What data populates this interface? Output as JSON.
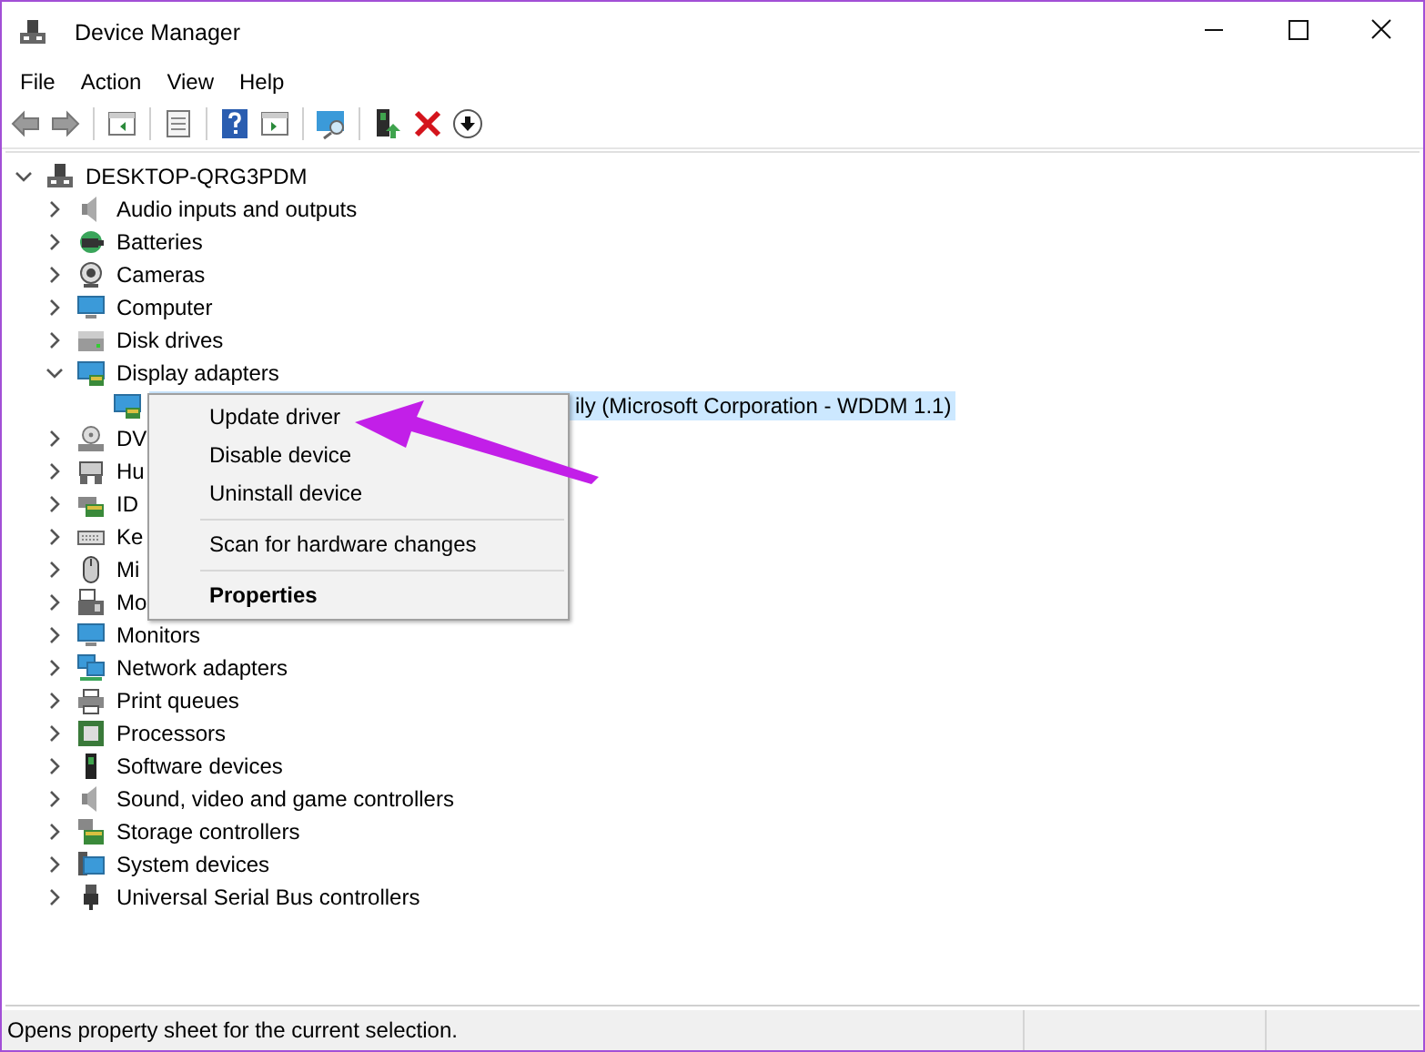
{
  "window": {
    "title": "Device Manager"
  },
  "menu_bar": [
    "File",
    "Action",
    "View",
    "Help"
  ],
  "tree": {
    "label": "DESKTOP-QRG3PDM",
    "expanded": true,
    "selected": false,
    "children": [
      {
        "label": "Audio inputs and outputs",
        "expanded": false,
        "selected": false
      },
      {
        "label": "Batteries",
        "expanded": false,
        "selected": false
      },
      {
        "label": "Cameras",
        "expanded": false,
        "selected": false
      },
      {
        "label": "Computer",
        "expanded": false,
        "selected": false
      },
      {
        "label": "Disk drives",
        "expanded": false,
        "selected": false
      },
      {
        "label": "Display adapters",
        "expanded": true,
        "selected": false,
        "children": [
          {
            "label": "ily (Microsoft Corporation - WDDM 1.1)",
            "selected": true
          }
        ]
      },
      {
        "label": "DV",
        "expanded": false,
        "selected": false
      },
      {
        "label": "Hu",
        "expanded": false,
        "selected": false
      },
      {
        "label": "ID",
        "expanded": false,
        "selected": false
      },
      {
        "label": "Ke",
        "expanded": false,
        "selected": false
      },
      {
        "label": "Mi",
        "expanded": false,
        "selected": false
      },
      {
        "label": "Mo",
        "expanded": false,
        "selected": false
      },
      {
        "label": "Monitors",
        "expanded": false,
        "selected": false
      },
      {
        "label": "Network adapters",
        "expanded": false,
        "selected": false
      },
      {
        "label": "Print queues",
        "expanded": false,
        "selected": false
      },
      {
        "label": "Processors",
        "expanded": false,
        "selected": false
      },
      {
        "label": "Software devices",
        "expanded": false,
        "selected": false
      },
      {
        "label": "Sound, video and game controllers",
        "expanded": false,
        "selected": false
      },
      {
        "label": "Storage controllers",
        "expanded": false,
        "selected": false
      },
      {
        "label": "System devices",
        "expanded": false,
        "selected": false
      },
      {
        "label": "Universal Serial Bus controllers",
        "expanded": false,
        "selected": false
      }
    ]
  },
  "context_menu": [
    {
      "kind": "item",
      "label": "Update driver",
      "default": false
    },
    {
      "kind": "item",
      "label": "Disable device",
      "default": false
    },
    {
      "kind": "item",
      "label": "Uninstall device",
      "default": false
    },
    {
      "kind": "separator"
    },
    {
      "kind": "item",
      "label": "Scan for hardware changes",
      "default": false
    },
    {
      "kind": "separator"
    },
    {
      "kind": "item",
      "label": "Properties",
      "default": true
    }
  ],
  "status_bar": {
    "text": "Opens property sheet for the current selection."
  }
}
